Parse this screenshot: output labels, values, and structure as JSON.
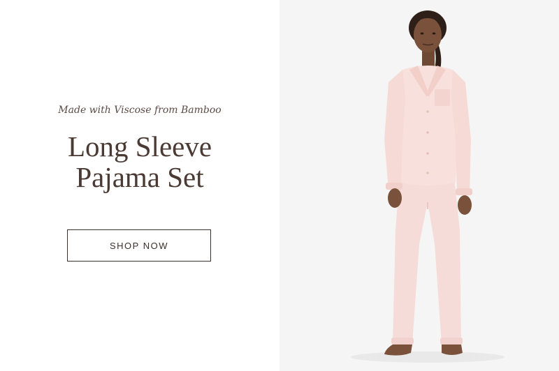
{
  "hero": {
    "eyebrow": "Made with Viscose from Bamboo",
    "title_line1": "Long Sleeve",
    "title_line2": "Pajama Set",
    "cta_label": "SHOP NOW"
  },
  "image": {
    "alt": "Model wearing pink long sleeve pajama set"
  },
  "colors": {
    "text": "#4a3a33",
    "button_border": "#3a2f2b",
    "photo_background": "#f5f5f5",
    "pajama_pink": "#f7d9d6"
  }
}
